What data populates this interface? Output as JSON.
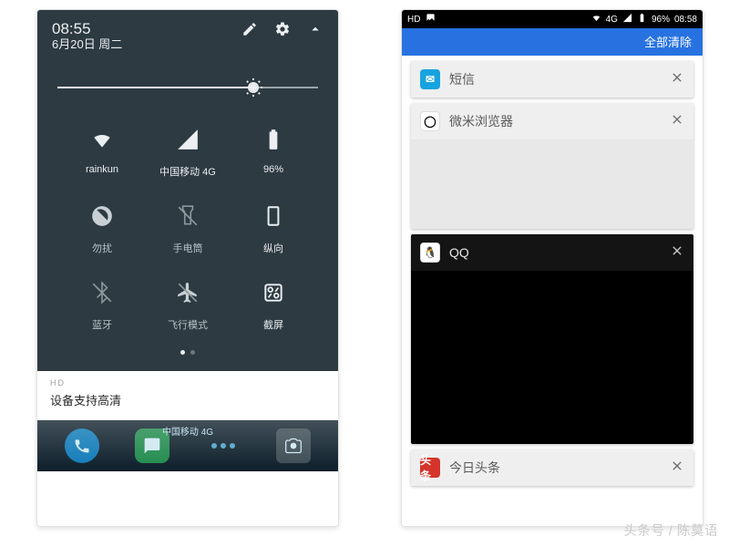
{
  "left": {
    "status": {
      "time": "08:55",
      "date": "6月20日 周二"
    },
    "brightness_percent": 75,
    "tiles": [
      {
        "id": "wifi",
        "label": "rainkun",
        "icon": "wifi-icon",
        "on": true
      },
      {
        "id": "cell",
        "label": "中国移动 4G",
        "icon": "cell-icon",
        "on": true
      },
      {
        "id": "battery",
        "label": "96%",
        "icon": "battery-icon",
        "on": true
      },
      {
        "id": "dnd",
        "label": "勿扰",
        "icon": "dnd-icon",
        "on": false
      },
      {
        "id": "torch",
        "label": "手电筒",
        "icon": "flashlight-icon",
        "on": false
      },
      {
        "id": "rotation",
        "label": "纵向",
        "icon": "portrait-icon",
        "on": true
      },
      {
        "id": "bt",
        "label": "蓝牙",
        "icon": "bluetooth-icon",
        "on": false
      },
      {
        "id": "airplane",
        "label": "飞行模式",
        "icon": "airplane-icon",
        "on": false
      },
      {
        "id": "screenshot",
        "label": "截屏",
        "icon": "screenshot-icon",
        "on": true
      }
    ],
    "hd_tag": "HD",
    "hd_text": "设备支持高清",
    "dock_carrier": "中国移动 4G"
  },
  "right": {
    "status": {
      "hd": "HD",
      "net": "4G",
      "battery": "96%",
      "time": "08:58"
    },
    "clear_all": "全部清除",
    "cards": [
      {
        "title": "短信",
        "dark": false,
        "body_h": 0,
        "icon_bg": "#17a3e0",
        "icon_txt": "✉"
      },
      {
        "title": "微米浏览器",
        "dark": false,
        "body_h": 98,
        "icon_bg": "#ffffff",
        "icon_txt": "◯"
      },
      {
        "title": "QQ",
        "dark": true,
        "body_h": 190,
        "icon_bg": "#ffffff",
        "icon_txt": "🐧"
      },
      {
        "title": "今日头条",
        "dark": false,
        "body_h": 0,
        "icon_bg": "#d4342b",
        "icon_txt": "头条"
      }
    ]
  },
  "watermark": "头条号 / 陈莫语"
}
